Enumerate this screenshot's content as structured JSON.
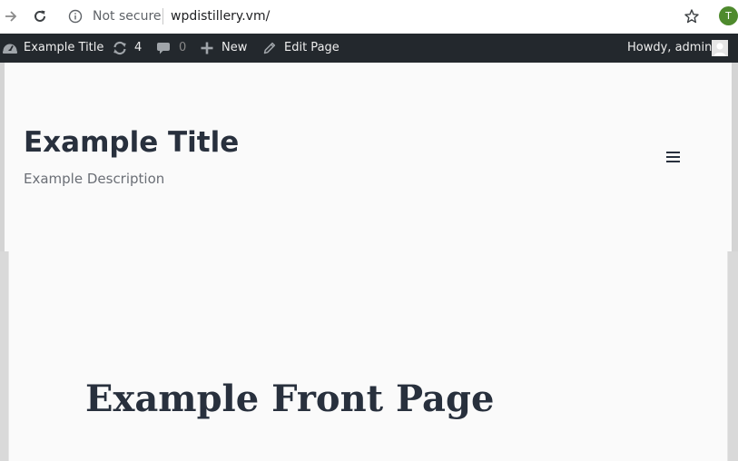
{
  "browser": {
    "security_label": "Not secure",
    "url": "wpdistillery.vm/",
    "profile_initial": "T",
    "profile_color": "#4e8a2d"
  },
  "adminbar": {
    "site_name": "Example Title",
    "updates_count": "4",
    "comments_count": "0",
    "new_label": "New",
    "edit_label": "Edit Page",
    "howdy_label": "Howdy, admin",
    "background": "#23282d"
  },
  "site": {
    "title": "Example Title",
    "description": "Example Description"
  },
  "page": {
    "title": "Example Front Page"
  }
}
